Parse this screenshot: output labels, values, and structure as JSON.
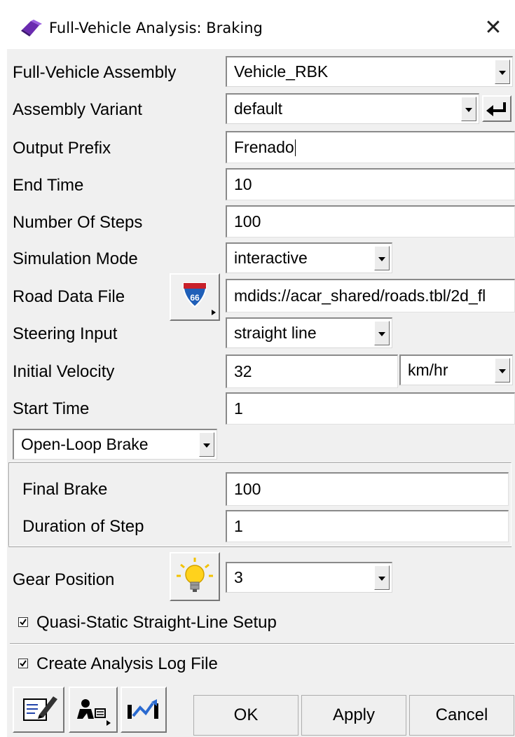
{
  "window": {
    "title": "Full-Vehicle Analysis: Braking",
    "close_glyph": "✕"
  },
  "form": {
    "assembly_label": "Full-Vehicle Assembly",
    "assembly_value": "Vehicle_RBK",
    "variant_label": "Assembly Variant",
    "variant_value": "default",
    "prefix_label": "Output Prefix",
    "prefix_value": "Frenado",
    "end_time_label": "End Time",
    "end_time_value": "10",
    "steps_label": "Number Of Steps",
    "steps_value": "100",
    "sim_mode_label": "Simulation Mode",
    "sim_mode_value": "interactive",
    "road_label": "Road Data File",
    "road_value": "mdids://acar_shared/roads.tbl/2d_fl",
    "road_button_icon": "interstate-66-icon",
    "road_badge_text": "66",
    "steering_label": "Steering Input",
    "steering_value": "straight line",
    "velocity_label": "Initial Velocity",
    "velocity_value": "32",
    "velocity_unit": "km/hr",
    "start_time_label": "Start Time",
    "start_time_value": "1",
    "brake_mode_value": "Open-Loop Brake",
    "final_brake_label": "Final Brake",
    "final_brake_value": "100",
    "duration_label": "Duration of Step",
    "duration_value": "1",
    "gear_label": "Gear Position",
    "gear_value": "3",
    "quasi_static_label": "Quasi-Static Straight-Line Setup",
    "quasi_static_checked": true,
    "log_file_label": "Create Analysis Log File",
    "log_file_checked": true
  },
  "footer": {
    "ok_label": "OK",
    "apply_label": "Apply",
    "cancel_label": "Cancel",
    "tool_icons": [
      "edit-notes-icon",
      "driver-settings-icon",
      "plot-signals-icon"
    ]
  },
  "colors": {
    "dialog_bg": "#f0f0f0",
    "field_bg": "#ffffff",
    "road_badge_blue": "#1f5fb8",
    "road_badge_red": "#c8202a",
    "bulb_yellow": "#ffd21c"
  }
}
